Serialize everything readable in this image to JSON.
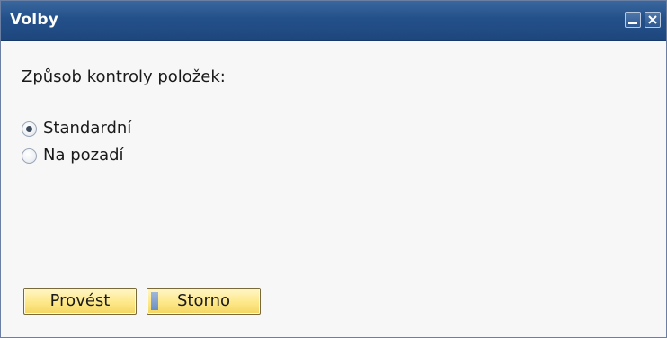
{
  "window": {
    "title": "Volby"
  },
  "content": {
    "label": "Způsob kontroly položek:",
    "options": [
      {
        "label": "Standardní",
        "selected": true
      },
      {
        "label": "Na pozadí",
        "selected": false
      }
    ]
  },
  "buttons": {
    "ok_label": "Provést",
    "cancel_label": "Storno"
  },
  "icons": {
    "minimize": "minimize-icon",
    "close": "close-icon"
  },
  "colors": {
    "titlebar": "#24508a",
    "button": "#fde889"
  }
}
